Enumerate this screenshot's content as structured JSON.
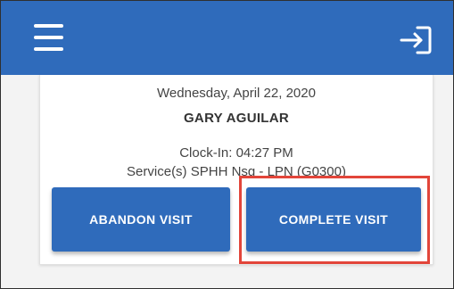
{
  "header": {
    "menu_icon": "hamburger-menu-icon",
    "logout_icon": "logout-icon",
    "background_color": "#2f6bbb"
  },
  "visit": {
    "date": "Wednesday, April 22, 2020",
    "client_name": "GARY AGUILAR",
    "clock_in": "Clock-In: 04:27 PM",
    "services": "Service(s) SPHH Nsg - LPN (G0300)"
  },
  "actions": {
    "abandon_label": "ABANDON VISIT",
    "complete_label": "COMPLETE VISIT"
  },
  "colors": {
    "button": "#2f6bbb",
    "highlight": "#e2453a"
  }
}
